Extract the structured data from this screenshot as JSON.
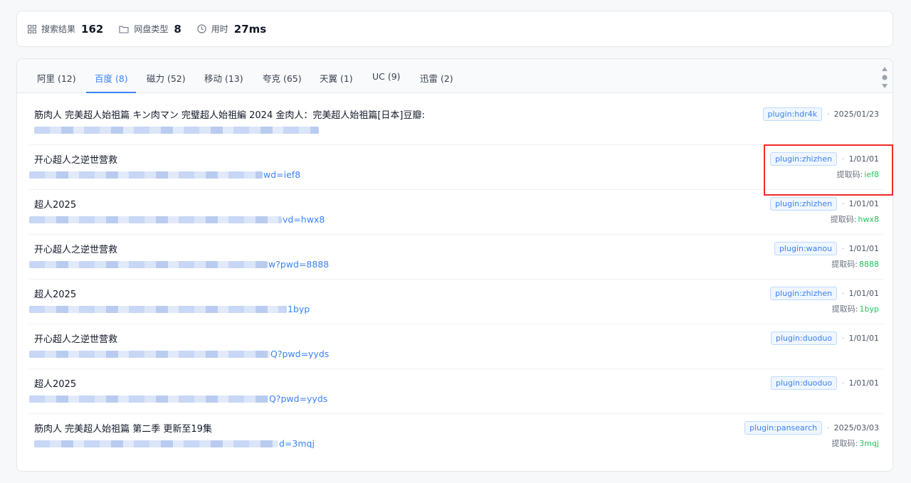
{
  "stats": {
    "results_label": "搜索结果",
    "results_value": "162",
    "types_label": "网盘类型",
    "types_value": "8",
    "time_label": "用时",
    "time_value": "27ms"
  },
  "tabs": [
    {
      "label": "阿里 (12)"
    },
    {
      "label": "百度 (8)"
    },
    {
      "label": "磁力 (52)"
    },
    {
      "label": "移动 (13)"
    },
    {
      "label": "夸克 (65)"
    },
    {
      "label": "天翼 (1)"
    },
    {
      "label": "UC (9)"
    },
    {
      "label": "迅雷 (2)"
    }
  ],
  "active_tab": "百度 (8)",
  "code_label": "提取码:",
  "rows": [
    {
      "title": "筋肉人 完美超人始祖篇 キン肉マン 完璧超人始祖編 2024 金肉人：完美超人始祖篇[日本]豆瓣:",
      "link_suffix": "",
      "plugin": "plugin:hdr4k",
      "date": "2025/01/23",
      "code": ""
    },
    {
      "title": "开心超人之逆世营救",
      "link_suffix": "wd=ief8",
      "plugin": "plugin:zhizhen",
      "date": "1/01/01",
      "code": "ief8"
    },
    {
      "title": "超人2025",
      "link_suffix": "vd=hwx8",
      "plugin": "plugin:zhizhen",
      "date": "1/01/01",
      "code": "hwx8"
    },
    {
      "title": "开心超人之逆世营救",
      "link_suffix": "w?pwd=8888",
      "plugin": "plugin:wanou",
      "date": "1/01/01",
      "code": "8888"
    },
    {
      "title": "超人2025",
      "link_suffix": "1byp",
      "plugin": "plugin:zhizhen",
      "date": "1/01/01",
      "code": "1byp"
    },
    {
      "title": "开心超人之逆世营救",
      "link_suffix": "Q?pwd=yyds",
      "plugin": "plugin:duoduo",
      "date": "1/01/01",
      "code": ""
    },
    {
      "title": "超人2025",
      "link_suffix": "Q?pwd=yyds",
      "plugin": "plugin:duoduo",
      "date": "1/01/01",
      "code": ""
    },
    {
      "title": "筋肉人 完美超人始祖篇 第二季 更新至19集",
      "link_suffix": "d=3mqj",
      "plugin": "plugin:pansearch",
      "date": "2025/03/03",
      "code": "3mqj"
    }
  ],
  "colors": {
    "accent": "#3b82f6",
    "code": "#22c55e",
    "highlight": "#ef2b2b"
  }
}
